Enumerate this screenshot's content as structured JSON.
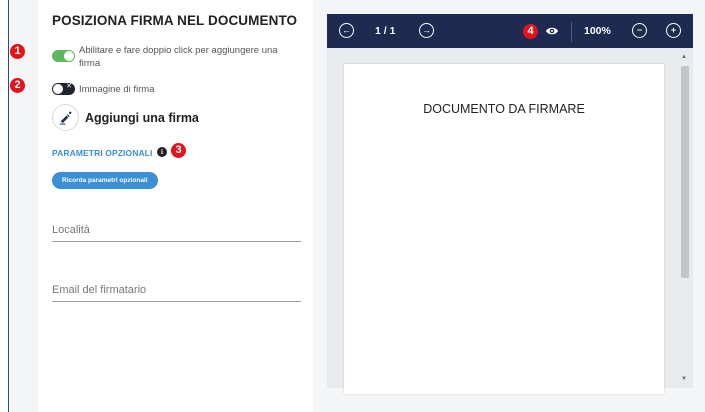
{
  "panel": {
    "title": "POSIZIONA FIRMA NEL DOCUMENTO",
    "markers": [
      "1",
      "2",
      "3",
      "4"
    ],
    "toggle_enable_label": "Abilitare e fare doppio click per aggiungere una firma",
    "toggle_enable_state": "on",
    "toggle_image_label": "Immagine di firma",
    "toggle_image_state": "off",
    "add_signature_label": "Aggiungi una firma",
    "optional_params_label": "PARAMETRI OPZIONALI",
    "remember_params_button": "Ricorda parametri opzionali",
    "location_placeholder": "Località",
    "email_placeholder": "Email del firmatario"
  },
  "viewer": {
    "page_indicator": "1 / 1",
    "zoom": "100%",
    "document_title": "DOCUMENTO DA FIRMARE",
    "toolbar_color": "#1c2b4f"
  },
  "colors": {
    "accent": "#3a8fd6",
    "toggle_on": "#5cb85c",
    "marker": "#e3121b"
  }
}
